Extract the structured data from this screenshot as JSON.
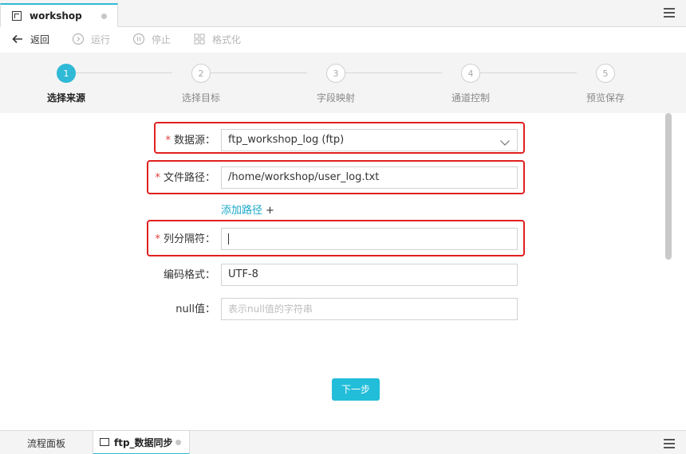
{
  "tab": {
    "title": "workshop"
  },
  "toolbar": {
    "back": "返回",
    "run": "运行",
    "stop": "停止",
    "format": "格式化"
  },
  "steps": [
    {
      "num": "1",
      "label": "选择来源",
      "active": true
    },
    {
      "num": "2",
      "label": "选择目标",
      "active": false
    },
    {
      "num": "3",
      "label": "字段映射",
      "active": false
    },
    {
      "num": "4",
      "label": "通道控制",
      "active": false
    },
    {
      "num": "5",
      "label": "预览保存",
      "active": false
    }
  ],
  "form": {
    "required_mark": "*",
    "datasource_label": "数据源：",
    "datasource_value": "ftp_workshop_log (ftp)",
    "filepath_label": "文件路径：",
    "filepath_value": "/home/workshop/user_log.txt",
    "add_path": "添加路径",
    "add_path_plus": "+",
    "delimiter_label": "列分隔符：",
    "delimiter_value": "",
    "encoding_label": "编码格式：",
    "encoding_value": "UTF-8",
    "null_label": "null值：",
    "null_placeholder": "表示null值的字符串"
  },
  "next_button": "下一步",
  "bottom_tabs": {
    "flow_panel": "流程面板",
    "sync_tab": "ftp_数据同步"
  },
  "colors": {
    "accent": "#22bdd9",
    "highlight": "#e02020",
    "required": "#e03c3c"
  }
}
